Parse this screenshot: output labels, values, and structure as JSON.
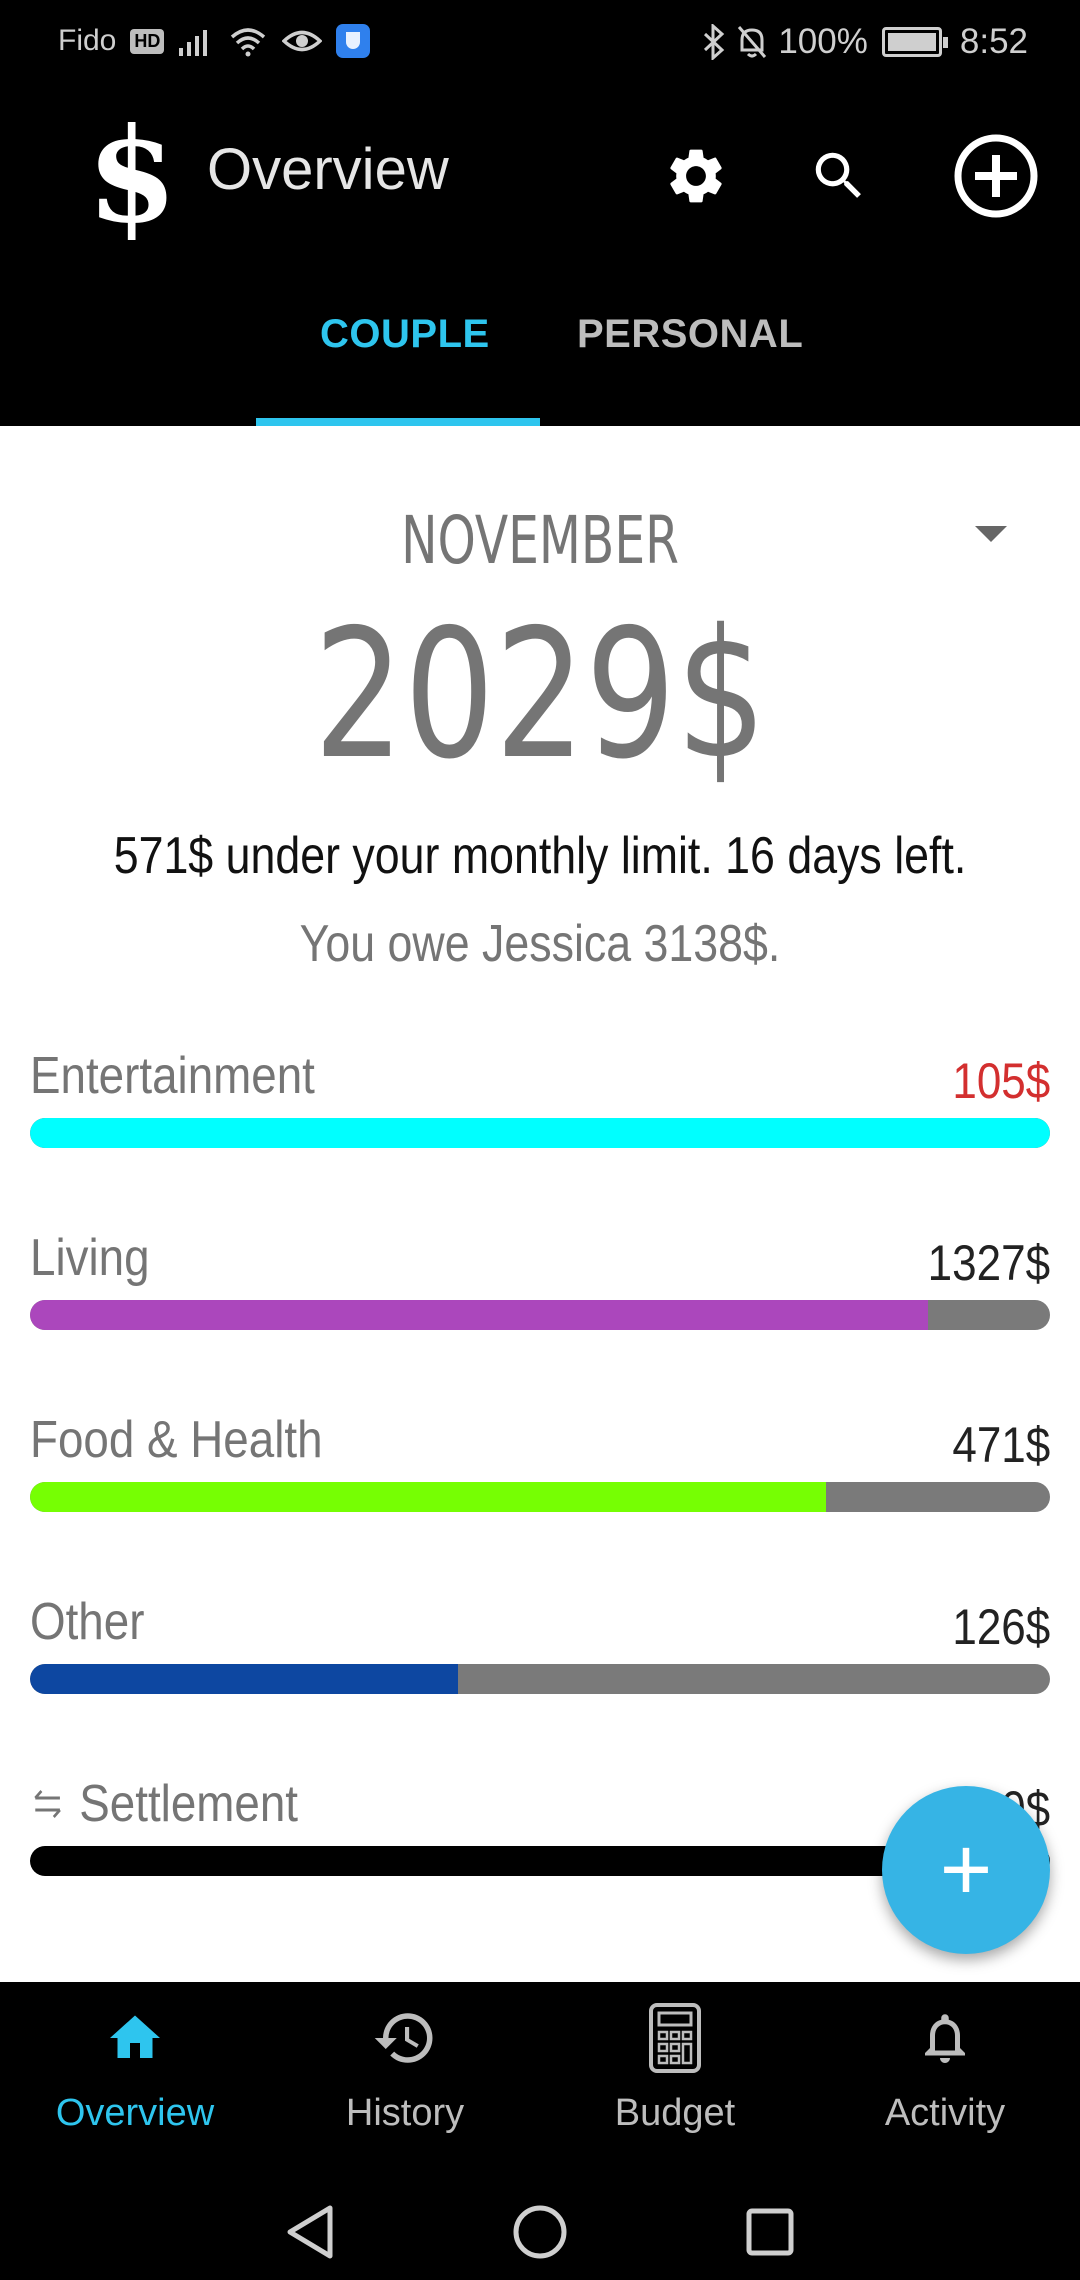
{
  "status_bar": {
    "carrier": "Fido",
    "network_badge": "HD",
    "battery": "100%",
    "time": "8:52"
  },
  "app_bar": {
    "logo_char": "$",
    "title": "Overview",
    "icons": [
      "gear-icon",
      "search-icon",
      "add-circle-icon"
    ]
  },
  "tabs": [
    {
      "label": "COUPLE",
      "active": true
    },
    {
      "label": "PERSONAL",
      "active": false
    }
  ],
  "summary": {
    "month": "NOVEMBER",
    "total": "2029$",
    "limit_text": "571$ under your monthly limit. 16 days left.",
    "owe_text": "You owe Jessica 3138$."
  },
  "categories": [
    {
      "name": "Entertainment",
      "amount": "105$",
      "fill_fraction": 1.0,
      "color": "#00ffff",
      "amount_color": "#d32f2f"
    },
    {
      "name": "Living",
      "amount": "1327$",
      "fill_fraction": 0.88,
      "color": "#ab47bc",
      "amount_color": "#222222"
    },
    {
      "name": "Food & Health",
      "amount": "471$",
      "fill_fraction": 0.78,
      "color": "#76ff03",
      "amount_color": "#222222"
    },
    {
      "name": "Other",
      "amount": "126$",
      "fill_fraction": 0.42,
      "color": "#0d47a1",
      "amount_color": "#222222"
    },
    {
      "name": "Settlement",
      "amount": "1000$",
      "fill_fraction": 1.0,
      "color": "#000000",
      "amount_color": "#222222",
      "icon": "swap-arrows-icon"
    }
  ],
  "fab": {
    "label": "+"
  },
  "bottom_nav": [
    {
      "label": "Overview",
      "icon": "home-icon",
      "active": true
    },
    {
      "label": "History",
      "icon": "history-icon",
      "active": false
    },
    {
      "label": "Budget",
      "icon": "calculator-icon",
      "active": false
    },
    {
      "label": "Activity",
      "icon": "bell-icon",
      "active": false
    }
  ],
  "system_nav": [
    "back-icon",
    "home-circle-icon",
    "recents-icon"
  ],
  "colors": {
    "accent": "#2ec5ee",
    "fab": "#36b4e5",
    "track": "#7a7a7a"
  }
}
